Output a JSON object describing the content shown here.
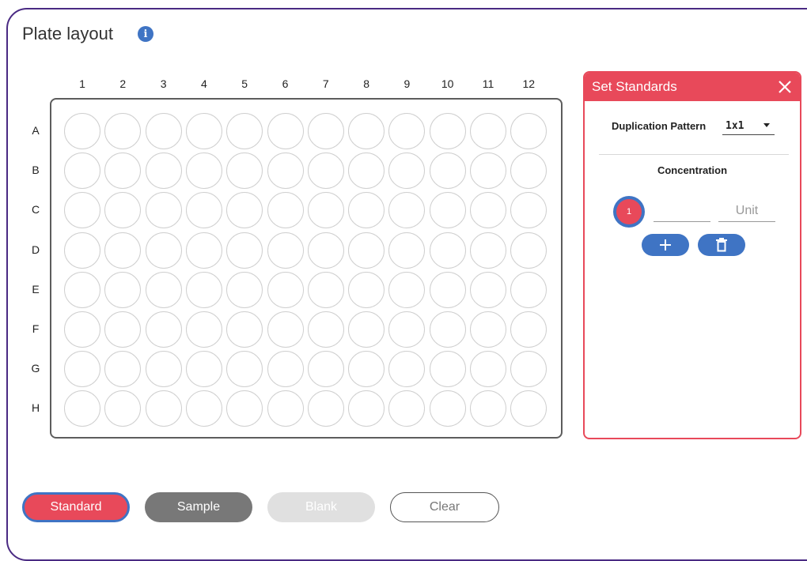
{
  "title": "Plate layout",
  "info_icon": "info-icon",
  "plate": {
    "columns": [
      "1",
      "2",
      "3",
      "4",
      "5",
      "6",
      "7",
      "8",
      "9",
      "10",
      "11",
      "12"
    ],
    "rows": [
      "A",
      "B",
      "C",
      "D",
      "E",
      "F",
      "G",
      "H"
    ]
  },
  "standards_panel": {
    "title": "Set Standards",
    "close_icon": "close-icon",
    "duplication_label": "Duplication Pattern",
    "duplication_value": "1x1",
    "concentration_label": "Concentration",
    "standard_number": "1",
    "concentration_value": "",
    "unit_placeholder": "Unit",
    "add_icon": "plus-icon",
    "delete_icon": "trash-icon"
  },
  "buttons": {
    "standard": "Standard",
    "sample": "Sample",
    "blank": "Blank",
    "clear": "Clear"
  },
  "colors": {
    "frame": "#4a2a83",
    "accent_red": "#e8495a",
    "accent_blue": "#3f74c4"
  }
}
